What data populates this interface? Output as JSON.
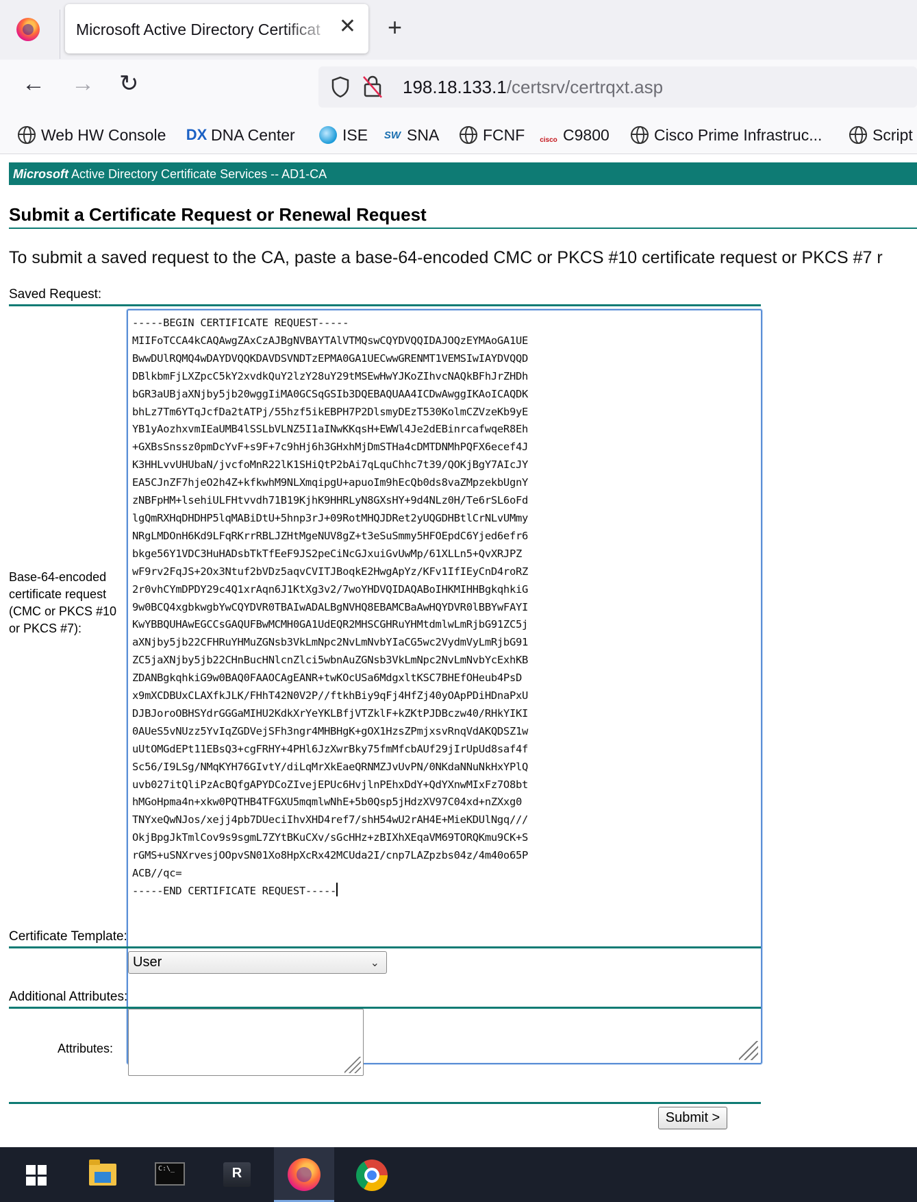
{
  "browser": {
    "tab_title": "Microsoft Active Directory Certificat",
    "close_glyph": "✕",
    "new_tab_glyph": "+",
    "back_glyph": "←",
    "forward_glyph": "→",
    "reload_glyph": "↻",
    "url_host": "198.18.133.1",
    "url_path": "/certsrv/certrqxt.asp"
  },
  "bookmarks": [
    {
      "label": "Web HW Console",
      "icon": "globe-icon"
    },
    {
      "label": "DNA Center",
      "icon": "dna-center-icon"
    },
    {
      "label": "ISE",
      "icon": "ise-icon"
    },
    {
      "label": "SNA",
      "icon": "sna-icon"
    },
    {
      "label": "FCNF",
      "icon": "globe-icon"
    },
    {
      "label": "C9800",
      "icon": "cisco-icon"
    },
    {
      "label": "Cisco Prime Infrastruc...",
      "icon": "globe-icon"
    },
    {
      "label": "Script",
      "icon": "globe-icon"
    }
  ],
  "bookmark_icon_text": {
    "dna": "DX",
    "sna": "SW",
    "cisco": "cisco"
  },
  "page": {
    "header_brand": "Microsoft",
    "header_text": " Active Directory Certificate Services  --  AD1-CA",
    "title": "Submit a Certificate Request or Renewal Request",
    "intro": "To submit a saved request to the CA, paste a base-64-encoded CMC or PKCS #10 certificate request or PKCS #7 r",
    "saved_request_label": "Saved Request:",
    "base64_label": "Base-64-encoded certificate request (CMC or PKCS #10 or PKCS #7):",
    "certificate_request_text": "-----BEGIN CERTIFICATE REQUEST-----\nMIIFoTCCA4kCAQAwgZAxCzAJBgNVBAYTAlVTMQswCQYDVQQIDAJOQzEYMAoGA1UE\nBwwDUlRQMQ4wDAYDVQQKDAVDSVNDTzEPMA0GA1UECwwGRENMT1VEMSIwIAYDVQQD\nDBlkbmFjLXZpcC5kY2xvdkQuY2lzY28uY29tMSEwHwYJKoZIhvcNAQkBFhJrZHDh\nbGR3aUBjaXNjby5jb20wggIiMA0GCSqGSIb3DQEBAQUAA4ICDwAwggIKAoICAQDK\nbhLz7Tm6YTqJcfDa2tATPj/55hzf5ikEBPH7P2DlsmyDEzT530KolmCZVzeKb9yE\nYB1yAozhxvmIEaUMB4lSSLbVLNZ5I1aINwKKqsH+EWWl4Je2dEBinrcafwqeR8Eh\n+GXBsSnssz0pmDcYvF+s9F+7c9hHj6h3GHxhMjDmSTHa4cDMTDNMhPQFX6ecef4J\nK3HHLvvUHUbaN/jvcfoMnR22lK1SHiQtP2bAi7qLquChhc7t39/QOKjBgY7AIcJY\nEA5CJnZF7hjeO2h4Z+kfkwhM9NLXmqipgU+apuoIm9hEcQb0ds8vaZMpzekbUgnY\nzNBFpHM+lsehiULFHtvvdh71B19KjhK9HHRLyN8GXsHY+9d4NLz0H/Te6rSL6oFd\nlgQmRXHqDHDHP5lqMABiDtU+5hnp3rJ+09RotMHQJDRet2yUQGDHBtlCrNLvUMmy\nNRgLMDOnH6Kd9LFqRKrrRBLJZHtMgeNUV8gZ+t3eSuSmmy5HFOEpdC6Yjed6efr6\nbkge56Y1VDC3HuHADsbTkTfEeF9JS2peCiNcGJxuiGvUwMp/61XLLn5+QvXRJPZ\nwF9rv2FqJS+2Ox3Ntuf2bVDz5aqvCVITJBoqkE2HwgApYz/KFv1IfIEyCnD4roRZ\n2r0vhCYmDPDY29c4Q1xrAqn6J1KtXg3v2/7woYHDVQIDAQABoIHKMIHHBgkqhkiG\n9w0BCQ4xgbkwgbYwCQYDVR0TBAIwADALBgNVHQ8EBAMCBaAwHQYDVR0lBBYwFAYI\nKwYBBQUHAwEGCCsGAQUFBwMCMH0GA1UdEQR2MHSCGHRuYHMtdmlwLmRjbG91ZC5j\naXNjby5jb22CFHRuYHMuZGNsb3VkLmNpc2NvLmNvbYIaCG5wc2VydmVyLmRjbG91\nZC5jaXNjby5jb22CHnBucHNlcnZlci5wbnAuZGNsb3VkLmNpc2NvLmNvbYcExhKB\nZDANBgkqhkiG9w0BAQ0FAAOCAgEANR+twKOcUSa6MdgxltKSC7BHEfOHeub4PsD\nx9mXCDBUxCLAXfkJLK/FHhT42N0V2P//ftkhBiy9qFj4HfZj40yOApPDiHDnaPxU\nDJBJoroOBHSYdrGGGaMIHU2KdkXrYeYKLBfjVTZklF+kZKtPJDBczw40/RHkYIKI\n0AUeS5vNUzz5YvIqZGDVejSFh3ngr4MHBHgK+gOX1HzsZPmjxsvRnqVdAKQDSZ1w\nuUtOMGdEPt11EBsQ3+cgFRHY+4PHl6JzXwrBky75fmMfcbAUf29jIrUpUd8saf4f\nSc56/I9LSg/NMqKYH76GIvtY/diLqMrXkEaeQRNMZJvUvPN/0NKdaNNuNkHxYPlQ\nuvb027itQliPzAcBQfgAPYDCoZIvejEPUc6HvjlnPEhxDdY+QdYXnwMIxFz7O8bt\nhMGoHpma4n+xkw0PQTHB4TFGXU5mqmlwNhE+5b0Qsp5jHdzXV97C04xd+nZXxg0\nTNYxeQwNJos/xejj4pb7DUeciIhvXHD4ref7/shH54wU2rAH4E+MieKDUlNgq///\nOkjBpgJkTmlCov9s9sgmL7ZYtBKuCXv/sGcHHz+zBIXhXEqaVM69TORQKmu9CK+S\nrGMS+uSNXrvesjOOpvSN01Xo8HpXcRx42MCUda2I/cnp7LAZpzbs04z/4m40o65P\nACB//qc=\n-----END CERTIFICATE REQUEST-----",
    "template_label": "Certificate Template:",
    "template_selected": "User",
    "additional_label": "Additional Attributes:",
    "attributes_label": "Attributes:",
    "attributes_value": "",
    "submit_label": "Submit >"
  },
  "taskbar": [
    {
      "name": "start-button"
    },
    {
      "name": "file-explorer"
    },
    {
      "name": "command-prompt"
    },
    {
      "name": "remote-desktop-manager"
    },
    {
      "name": "firefox",
      "active": true
    },
    {
      "name": "chrome"
    }
  ],
  "colors": {
    "accent": "#0e7b74",
    "taskbar": "#1a1f2b"
  }
}
